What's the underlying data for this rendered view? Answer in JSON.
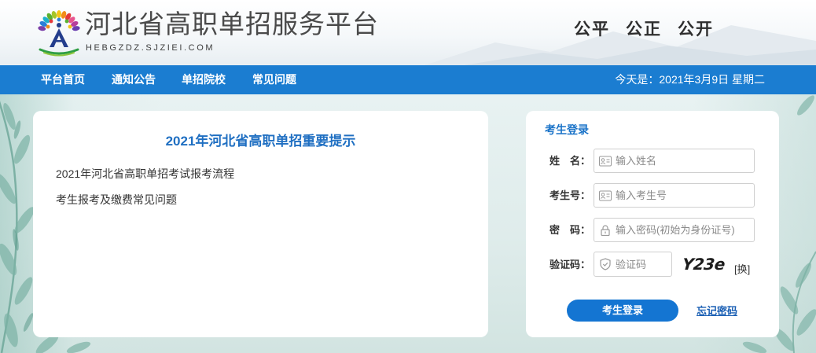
{
  "header": {
    "logo_icon": "tree-logo-icon",
    "site_title": "河北省高职单招服务平台",
    "site_domain": "HEBGZDZ.SJZIEI.COM",
    "slogans": [
      "公平",
      "公正",
      "公开"
    ]
  },
  "nav": {
    "items": [
      {
        "label": "平台首页"
      },
      {
        "label": "通知公告"
      },
      {
        "label": "单招院校"
      },
      {
        "label": "常见问题"
      }
    ],
    "date_text": "今天是：2021年3月9日 星期二"
  },
  "notice": {
    "title": "2021年河北省高职单招重要提示",
    "links": [
      {
        "label": "2021年河北省高职单招考试报考流程"
      },
      {
        "label": "考生报考及缴费常见问题"
      }
    ]
  },
  "login": {
    "title": "考生登录",
    "fields": [
      {
        "label": "姓　名：",
        "placeholder": "输入姓名",
        "icon": "id-card-icon"
      },
      {
        "label": "考生号：",
        "placeholder": "输入考生号",
        "icon": "id-card-icon"
      },
      {
        "label": "密　码：",
        "placeholder": "输入密码(初始为身份证号)",
        "icon": "lock-icon"
      }
    ],
    "captcha": {
      "label": "验证码：",
      "placeholder": "验证码",
      "icon": "shield-icon",
      "image_text": "Y23e",
      "refresh_label": "[换]"
    },
    "submit_label": "考生登录",
    "forgot_label": "忘记密码"
  },
  "colors": {
    "nav_bg": "#1b7dd1",
    "accent_blue": "#1a73c8",
    "button_bg": "#1475d2",
    "card_bg": "#ffffff"
  }
}
